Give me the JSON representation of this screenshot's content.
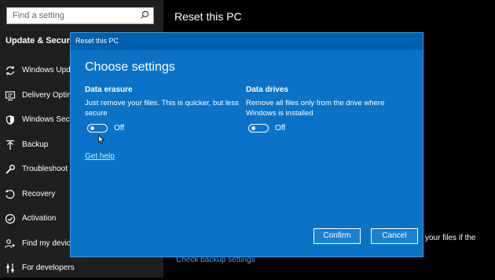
{
  "sidebar": {
    "search_placeholder": "Find a setting",
    "section_title": "Update & Security",
    "items": [
      {
        "label": "Windows Update",
        "icon": "sync-icon"
      },
      {
        "label": "Delivery Optimization",
        "icon": "delivery-icon"
      },
      {
        "label": "Windows Security",
        "icon": "shield-icon"
      },
      {
        "label": "Backup",
        "icon": "backup-arrow-icon"
      },
      {
        "label": "Troubleshoot",
        "icon": "wrench-icon"
      },
      {
        "label": "Recovery",
        "icon": "recovery-icon"
      },
      {
        "label": "Activation",
        "icon": "check-circle-icon"
      },
      {
        "label": "Find my device",
        "icon": "person-pin-icon"
      },
      {
        "label": "For developers",
        "icon": "developer-icon"
      }
    ]
  },
  "page": {
    "title": "Reset this PC",
    "partial_text": "your files if the",
    "partial_link": "Check backup settings"
  },
  "dialog": {
    "title": "Reset this PC",
    "heading": "Choose settings",
    "data_erasure": {
      "label": "Data erasure",
      "description_line1": "Just remove your files. This is quicker, but less",
      "description_line2": "secure",
      "toggle_state": "Off"
    },
    "data_drives": {
      "label": "Data drives",
      "description_line1": "Remove all files only from the drive where",
      "description_line2": "Windows is installed",
      "toggle_state": "Off"
    },
    "help_link": "Get help",
    "confirm_label": "Confirm",
    "cancel_label": "Cancel"
  },
  "colors": {
    "dialog_bg": "#0b73c7",
    "titlebar_bg": "#0060b0",
    "sidebar_bg": "#1f1f1f",
    "page_bg": "#000000"
  }
}
